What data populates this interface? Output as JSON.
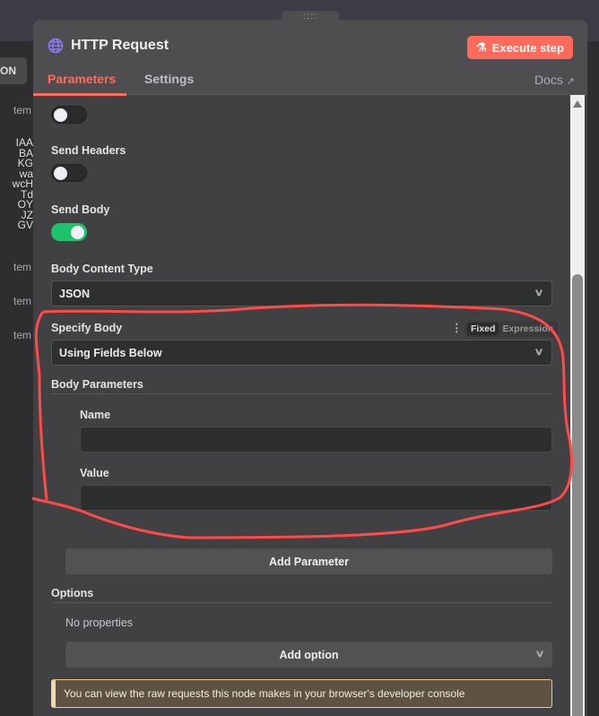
{
  "left_column": {
    "button": "ON",
    "items": [
      "tem",
      "tem",
      "tem",
      "tem"
    ],
    "codes": [
      "IAA",
      "BA",
      "KG",
      "wa",
      "wcH",
      "Td",
      "OY",
      "JZ",
      "GV"
    ]
  },
  "panel": {
    "handle": "::::",
    "title": "HTTP Request",
    "execute_label": "Execute step",
    "tabs": [
      "Parameters",
      "Settings"
    ],
    "docs_label": "Docs",
    "send_headers_label": "Send Headers",
    "send_headers_on": false,
    "send_body_label": "Send Body",
    "send_body_on": true,
    "body_content_type_label": "Body Content Type",
    "body_content_type_value": "JSON",
    "specify_body_label": "Specify Body",
    "mode_fixed": "Fixed",
    "mode_expression": "Expression",
    "specify_body_value": "Using Fields Below",
    "body_parameters_label": "Body Parameters",
    "name_label": "Name",
    "name_value": "",
    "value_label": "Value",
    "value_value": "",
    "add_parameter_label": "Add Parameter",
    "options_label": "Options",
    "no_properties": "No properties",
    "add_option_label": "Add option",
    "notice": "You can view the raw requests this node makes in your browser's developer console"
  },
  "colors": {
    "accent": "#ff6b5a",
    "toggle_on": "#1ec26a",
    "annotation": "#ff4a4a"
  }
}
